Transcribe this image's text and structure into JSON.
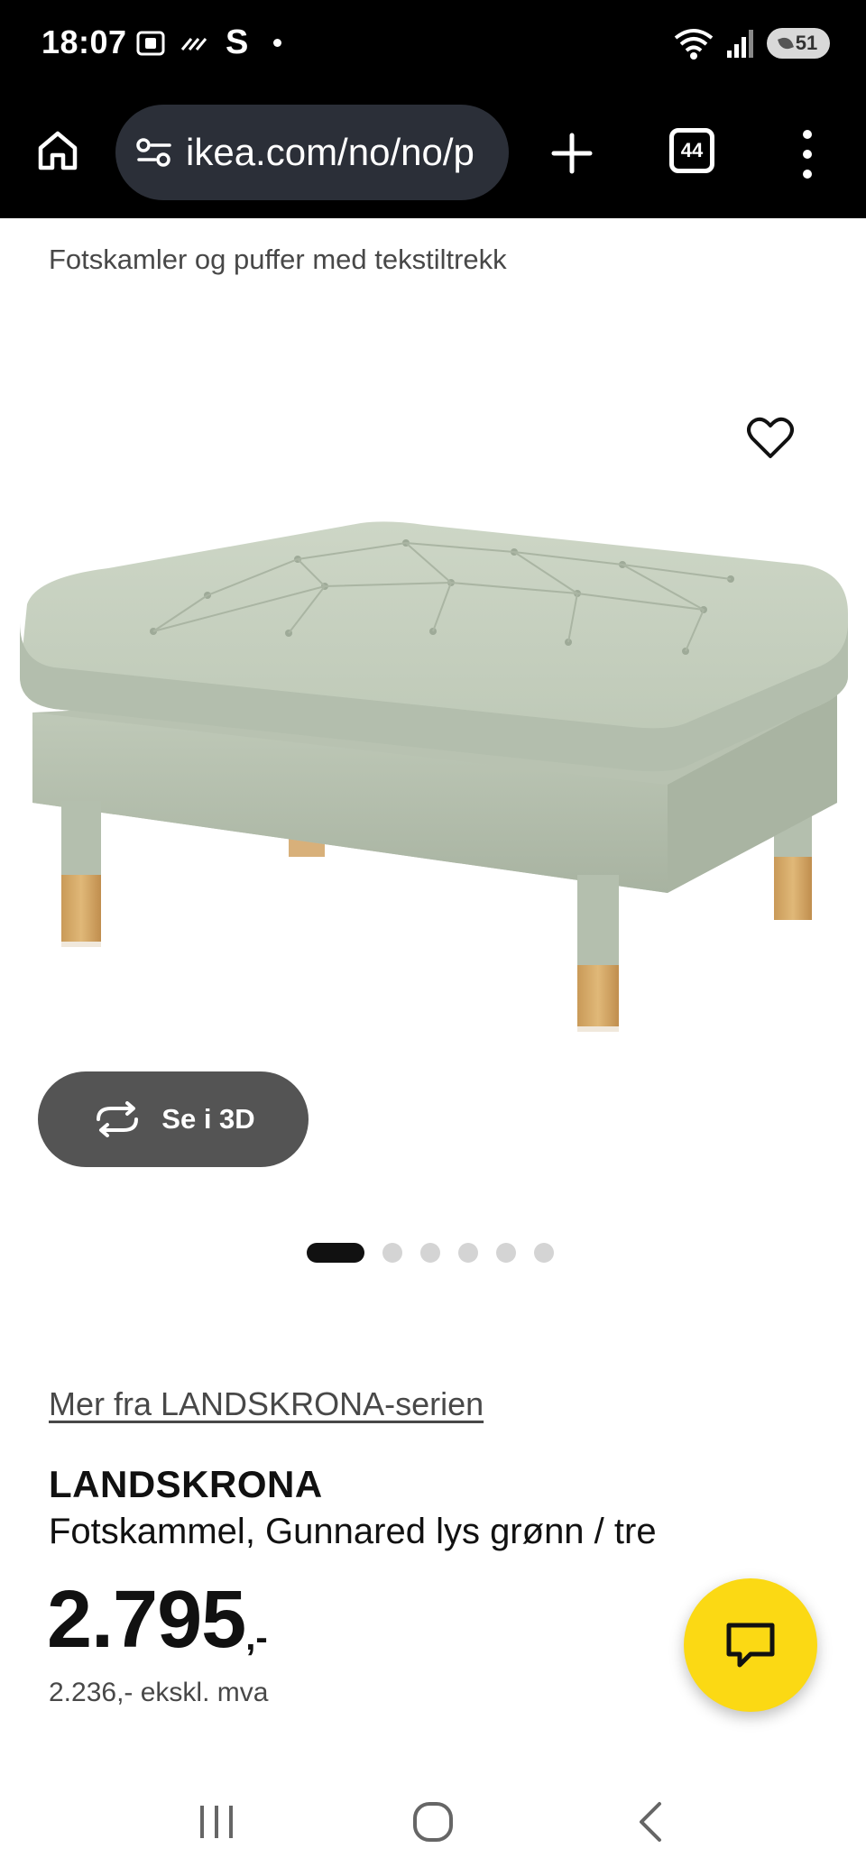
{
  "status_bar": {
    "time": "18:07",
    "carrier_letter": "S",
    "battery": "51",
    "icons": [
      "screenshot-icon",
      "nfc-icon",
      "wifi-icon",
      "signal-icon",
      "battery-icon"
    ]
  },
  "browser": {
    "url": "ikea.com/no/no/p",
    "tab_count": "44",
    "icons": [
      "home-icon",
      "site-settings-icon",
      "new-tab-icon",
      "tabs-icon",
      "more-icon"
    ]
  },
  "product": {
    "category": "Fotskamler og puffer med tekstiltrekk",
    "view_3d_label": "Se i 3D",
    "image_count": 6,
    "active_image": 1,
    "series_link": "Mer fra LANDSKRONA-serien",
    "name": "LANDSKRONA",
    "description": "Fotskammel, Gunnared lys grønn / tre",
    "price": "2.795",
    "price_suffix": ",-",
    "price_ex_vat": "2.236,- ekskl. mva",
    "fabric_color": "#c5cfbf",
    "leg_color": "#d7a968"
  },
  "colors": {
    "chat_button": "#fbd914",
    "status_bar_bg": "#000000",
    "url_box_bg": "#2b2f38"
  }
}
